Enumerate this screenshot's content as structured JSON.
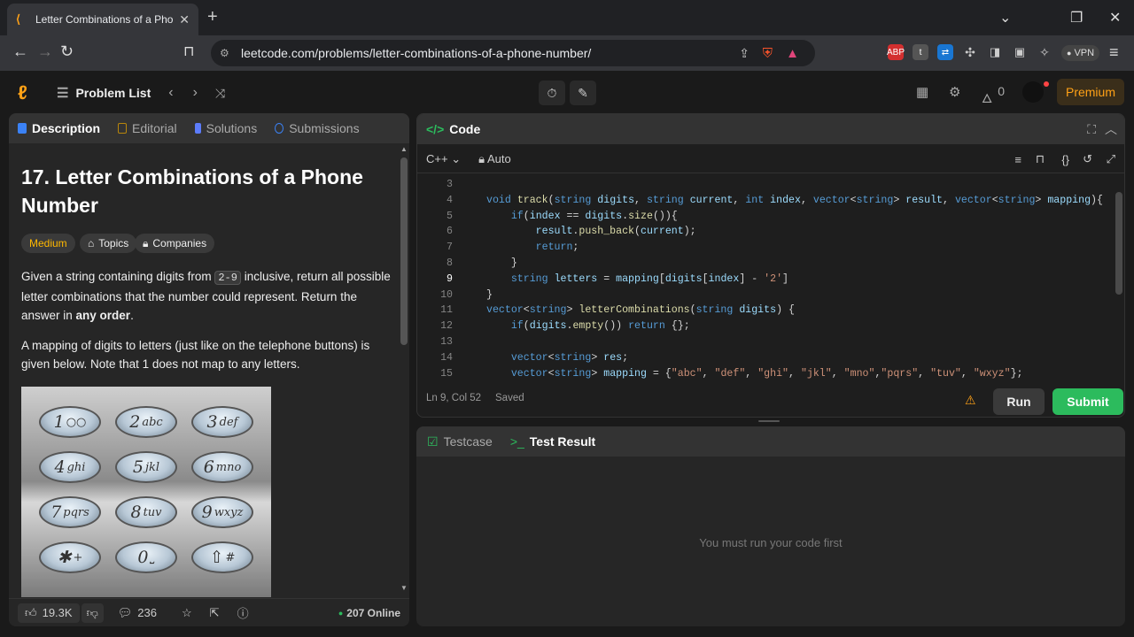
{
  "browser": {
    "tab_title": "Letter Combinations of a Phone",
    "url": "leetcode.com/problems/letter-combinations-of-a-phone-number/",
    "vpn_label": "VPN",
    "ext_badge_1": "ABP",
    "ext_badge_2": "t"
  },
  "header": {
    "problem_list": "Problem List",
    "streak_count": "0",
    "premium": "Premium"
  },
  "left_tabs": [
    "Description",
    "Editorial",
    "Solutions",
    "Submissions"
  ],
  "problem": {
    "title": "17. Letter Combinations of a Phone Number",
    "difficulty": "Medium",
    "topics": "Topics",
    "companies": "Companies",
    "p1_a": "Given a string containing digits from ",
    "p1_code": "2-9",
    "p1_b": " inclusive, return all possible letter combinations that the number could represent. Return the answer in ",
    "p1_bold": "any order",
    "p1_end": ".",
    "p2": "A mapping of digits to letters (just like on the telephone buttons) is given below. Note that 1 does not map to any letters.",
    "keys": [
      {
        "d": "1",
        "l": "○○"
      },
      {
        "d": "2",
        "l": "abc"
      },
      {
        "d": "3",
        "l": "def"
      },
      {
        "d": "4",
        "l": "ghi"
      },
      {
        "d": "5",
        "l": "jkl"
      },
      {
        "d": "6",
        "l": "mno"
      },
      {
        "d": "7",
        "l": "pqrs"
      },
      {
        "d": "8",
        "l": "tuv"
      },
      {
        "d": "9",
        "l": "wxyz"
      },
      {
        "d": "✱",
        "l": "+"
      },
      {
        "d": "0",
        "l": "⎵"
      },
      {
        "d": "⇧",
        "l": "#"
      }
    ]
  },
  "left_footer": {
    "likes": "19.3K",
    "comments": "236",
    "online": "207 Online"
  },
  "code_panel": {
    "title": "Code",
    "language": "C++",
    "autocomplete": "Auto",
    "status_pos": "Ln 9, Col 52",
    "status_saved": "Saved",
    "run": "Run",
    "submit": "Submit"
  },
  "code_lines": [
    {
      "n": "3",
      "t": ""
    },
    {
      "n": "4",
      "t": "void track(string digits, string current, int index, vector<string> result, vector<string> mapping){"
    },
    {
      "n": "5",
      "t": "    if(index == digits.size()){"
    },
    {
      "n": "6",
      "t": "        result.push_back(current);"
    },
    {
      "n": "7",
      "t": "        return;"
    },
    {
      "n": "8",
      "t": "    }"
    },
    {
      "n": "9",
      "t": "    string letters = mapping[digits[index] - '2']"
    },
    {
      "n": "10",
      "t": "}"
    },
    {
      "n": "11",
      "t": "vector<string> letterCombinations(string digits) {"
    },
    {
      "n": "12",
      "t": "    if(digits.empty()) return {};"
    },
    {
      "n": "13",
      "t": ""
    },
    {
      "n": "14",
      "t": "    vector<string> res;"
    },
    {
      "n": "15",
      "t": "    vector<string> mapping = {\"abc\", \"def\", \"ghi\", \"jkl\", \"mno\",\"pqrs\", \"tuv\", \"wxyz\"};"
    }
  ],
  "result_panel": {
    "tab_testcase": "Testcase",
    "tab_result": "Test Result",
    "message": "You must run your code first"
  }
}
